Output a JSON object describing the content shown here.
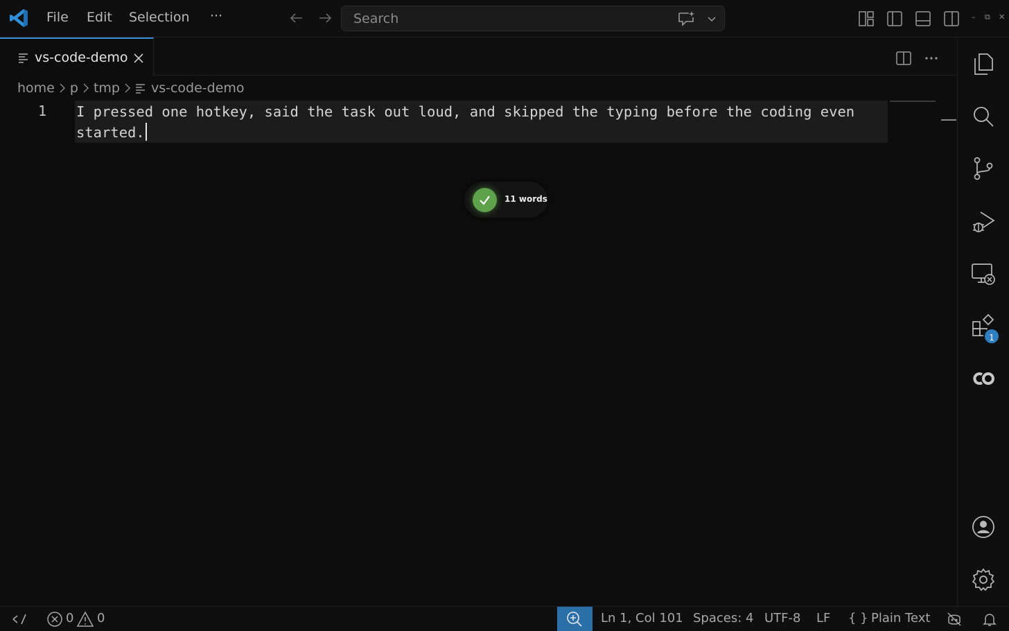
{
  "titlebar": {
    "menu": [
      "File",
      "Edit",
      "Selection",
      "···"
    ],
    "search_placeholder": "Search",
    "window_controls": [
      "–",
      "⧉",
      "✕"
    ]
  },
  "icons": {
    "app_logo": "vscode-logo-icon",
    "back": "arrow-left-icon",
    "forward": "arrow-right-icon",
    "copilot_chat": "copilot-chat-icon",
    "search_dropdown": "chevron-down-icon",
    "layout": [
      "customize-layout-icon",
      "toggle-primary-sidebar-icon",
      "toggle-panel-icon",
      "toggle-secondary-sidebar-icon"
    ],
    "activity": [
      "explorer-icon",
      "search-icon",
      "source-control-icon",
      "run-debug-icon",
      "remote-explorer-icon",
      "extensions-icon",
      "copilot-icon",
      "accounts-icon",
      "settings-icon"
    ]
  },
  "tab": {
    "label": "vs-code-demo",
    "accent": "#3b8fd4"
  },
  "breadcrumb": [
    "home",
    "p",
    "tmp",
    "vs-code-demo"
  ],
  "editor": {
    "line_number": "1",
    "text": "I pressed one hotkey, said the task out loud, and skipped the typing before the coding even started."
  },
  "toast": {
    "message": "11 words",
    "color": "#5da14a"
  },
  "activity": {
    "extensions_badge": "1"
  },
  "statusbar": {
    "errors": "0",
    "warnings": "0",
    "position": "Ln 1, Col 101",
    "spaces": "Spaces: 4",
    "encoding": "UTF-8",
    "eol": "LF",
    "language_braces": "{ }",
    "language": "Plain Text",
    "zoom_color": "#2b6fa8"
  }
}
